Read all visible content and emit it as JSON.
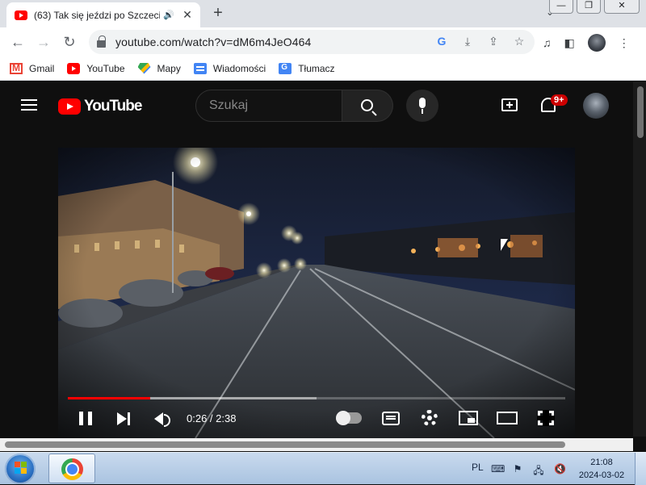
{
  "browser": {
    "tab": {
      "title": "(63) Tak się jeździ po Szczeci",
      "close_glyph": "✕",
      "audio_glyph": "🔊"
    },
    "new_tab_glyph": "+",
    "tab_search_glyph": "⌄",
    "window_controls": {
      "minimize": "—",
      "restore": "❐",
      "close": "✕"
    },
    "nav": {
      "back": "←",
      "forward": "→",
      "reload": "↻"
    },
    "url": "youtube.com/watch?v=dM6m4JeO464",
    "omnibox_icons": {
      "google": "G",
      "install": "⤓",
      "share": "⇪",
      "bookmark": "☆"
    },
    "toolbar_icons": {
      "media": "♫",
      "side_panel": "◧"
    },
    "bookmarks": [
      {
        "label": "Gmail",
        "icon": "gmail-icon"
      },
      {
        "label": "YouTube",
        "icon": "youtube-icon"
      },
      {
        "label": "Mapy",
        "icon": "maps-icon"
      },
      {
        "label": "Wiadomości",
        "icon": "news-icon"
      },
      {
        "label": "Tłumacz",
        "icon": "translate-icon"
      }
    ]
  },
  "youtube": {
    "logo_text": "YouTube",
    "search_placeholder": "Szukaj",
    "notifications_badge": "9+"
  },
  "player": {
    "current_time": "0:26",
    "duration": "2:38",
    "time_display": "0:26 / 2:38",
    "progress_fraction": 0.165,
    "buffered_fraction": 0.5,
    "state": "playing"
  },
  "taskbar": {
    "language": "PL",
    "time": "21:08",
    "date": "2024-03-02"
  },
  "colors": {
    "yt_red": "#ff0000",
    "yt_bg": "#0f0f0f",
    "chrome_tabstrip": "#dee1e6",
    "taskbar": "#a9c3e0"
  }
}
